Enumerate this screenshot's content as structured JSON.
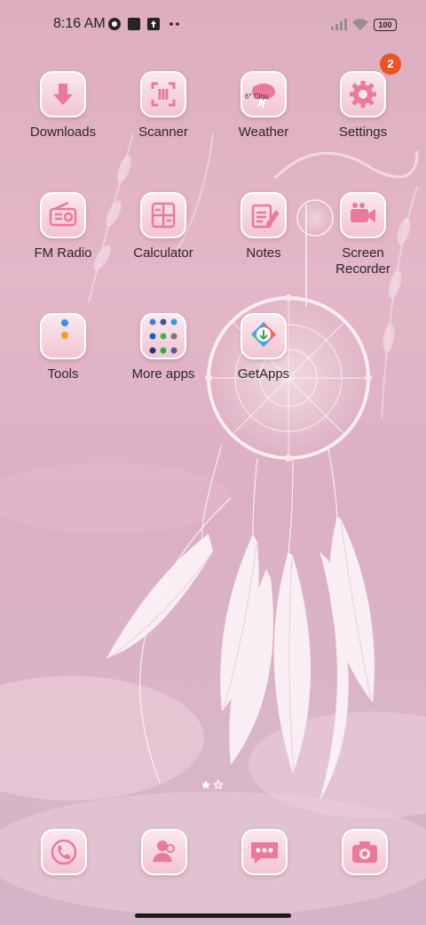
{
  "status_bar": {
    "time": "8:16 AM",
    "battery": "100",
    "icons": [
      "app-notification-icon",
      "square-notification-icon",
      "upload-notification-icon",
      "more-dots-icon",
      "signal-icon",
      "wifi-icon",
      "battery-icon"
    ]
  },
  "settings_badge": "2",
  "apps_row1": [
    {
      "label": "Downloads",
      "icon": "download-icon"
    },
    {
      "label": "Scanner",
      "icon": "scan-icon"
    },
    {
      "label": "Weather",
      "icon": "cloud-icon",
      "widget_text": "6° Clou"
    },
    {
      "label": "Settings",
      "icon": "gear-icon"
    }
  ],
  "apps_row2": [
    {
      "label": "FM Radio",
      "icon": "radio-icon"
    },
    {
      "label": "Calculator",
      "icon": "calculator-icon"
    },
    {
      "label": "Notes",
      "icon": "notes-icon"
    },
    {
      "label": "Screen\nRecorder",
      "icon": "video-camera-icon"
    }
  ],
  "apps_row3": [
    {
      "label": "Tools",
      "icon": "folder-icon"
    },
    {
      "label": "More apps",
      "icon": "folder-icon"
    },
    {
      "label": "GetApps",
      "icon": "getapps-icon"
    }
  ],
  "dock": [
    "phone-icon",
    "contacts-icon",
    "messages-icon",
    "camera-icon"
  ],
  "accent": "#ee5422"
}
